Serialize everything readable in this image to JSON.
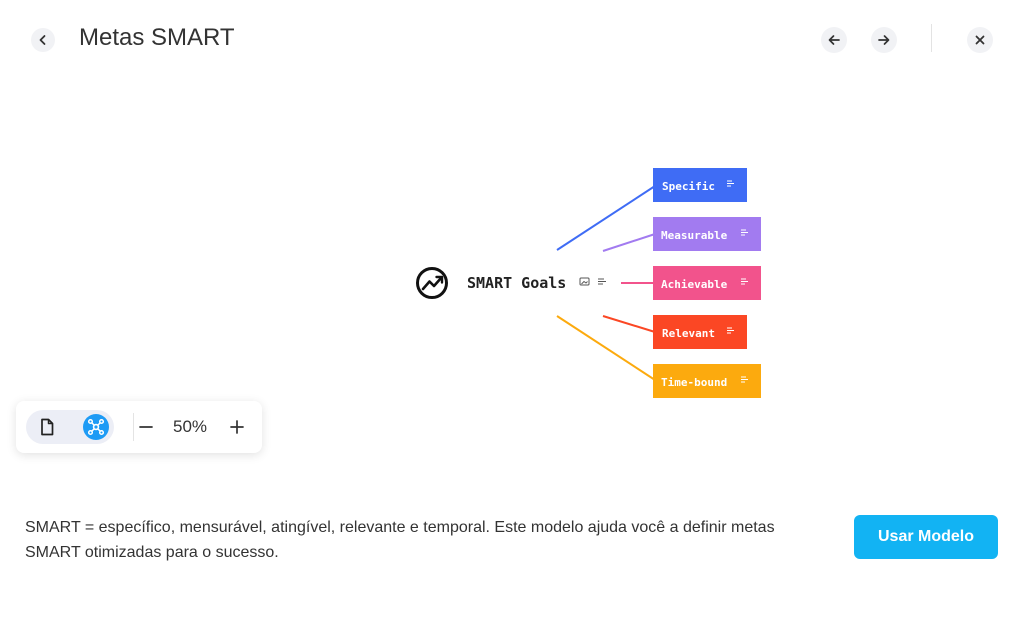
{
  "header": {
    "title": "Metas SMART",
    "back_icon": "chevron-left-icon",
    "prev_icon": "arrow-left-icon",
    "next_icon": "arrow-right-icon",
    "close_icon": "close-icon"
  },
  "mindmap": {
    "root": {
      "label": "SMART Goals",
      "icon": "trending-up-circle-icon"
    },
    "branches": [
      {
        "label": "Specific",
        "color": "#3f6cf5"
      },
      {
        "label": "Measurable",
        "color": "#a27bf0"
      },
      {
        "label": "Achievable",
        "color": "#f2538c"
      },
      {
        "label": "Relevant",
        "color": "#fb4724"
      },
      {
        "label": "Time-bound",
        "color": "#fcaa0e"
      }
    ]
  },
  "toolbar": {
    "zoom": "50%",
    "doc_view_icon": "document-icon",
    "mindmap_view_icon": "mindmap-icon",
    "active_view": "mindmap"
  },
  "footer": {
    "description": "SMART = específico, mensurável, atingível, relevante e temporal. Este modelo ajuda você a definir metas SMART otimizadas para o sucesso.",
    "button": "Usar Modelo"
  },
  "colors": {
    "accent": "#12b3f3"
  }
}
